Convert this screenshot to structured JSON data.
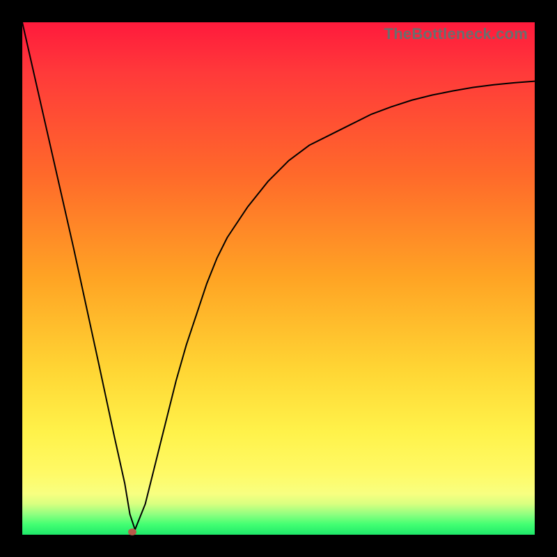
{
  "watermark": "TheBottleneck.com",
  "chart_data": {
    "type": "line",
    "title": "",
    "xlabel": "",
    "ylabel": "",
    "xlim": [
      0,
      100
    ],
    "ylim": [
      0,
      100
    ],
    "grid": false,
    "series": [
      {
        "name": "curve",
        "x": [
          0,
          5,
          10,
          15,
          18,
          20,
          21,
          22,
          24,
          26,
          28,
          30,
          32,
          34,
          36,
          38,
          40,
          44,
          48,
          52,
          56,
          60,
          64,
          68,
          72,
          76,
          80,
          84,
          88,
          92,
          96,
          100
        ],
        "values": [
          100,
          78,
          56,
          33,
          19,
          10,
          4,
          1,
          6,
          14,
          22,
          30,
          37,
          43,
          49,
          54,
          58,
          64,
          69,
          73,
          76,
          78,
          80,
          82,
          83.5,
          84.8,
          85.8,
          86.6,
          87.3,
          87.8,
          88.2,
          88.5
        ]
      }
    ],
    "marker": {
      "x": 21.5,
      "y": 0.5,
      "color": "#b85a4a"
    },
    "background_gradient": {
      "from": "#ff1a3c",
      "through": [
        "#ff6a2a",
        "#ffd634",
        "#fffa66"
      ],
      "to": "#1fe86a"
    }
  }
}
